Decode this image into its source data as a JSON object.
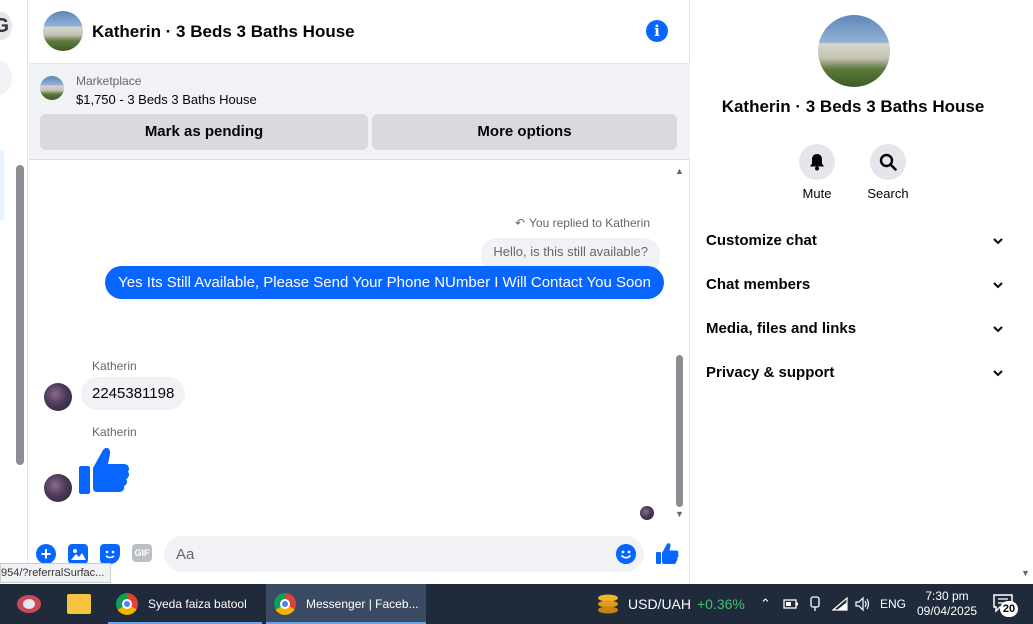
{
  "chat": {
    "title": "Katherin · 3 Beds 3 Baths House",
    "marketplace": {
      "label": "Marketplace",
      "listing": "$1,750 - 3 Beds 3 Baths House",
      "pending_label": "Mark as pending",
      "more_label": "More options"
    },
    "messages": {
      "replied_label": "You replied to Katherin",
      "quoted": "Hello, is this still available?",
      "outgoing": "Yes Its Still Available, Please Send Your Phone NUmber I Will Contact You Soon",
      "sender1": "Katherin",
      "incoming": "2245381198",
      "sender2": "Katherin"
    },
    "composer": {
      "placeholder": "Aa",
      "gif_label": "GIF"
    }
  },
  "url_hint": "954/?referralSurfac...",
  "details": {
    "title": "Katherin · 3 Beds 3 Baths House",
    "actions": [
      {
        "label": "Mute",
        "icon": "bell-icon"
      },
      {
        "label": "Search",
        "icon": "search-icon"
      }
    ],
    "sections": [
      {
        "label": "Customize chat"
      },
      {
        "label": "Chat members"
      },
      {
        "label": "Media, files and links"
      },
      {
        "label": "Privacy & support"
      }
    ]
  },
  "taskbar": {
    "apps": [
      {
        "label": "Syeda faiza batool -..."
      },
      {
        "label": "Messenger | Faceb..."
      }
    ],
    "ticker": {
      "name": "USD/UAH",
      "change": "+0.36%"
    },
    "language": "ENG",
    "time": "7:30 pm",
    "date": "09/04/2025",
    "notifications": "20"
  },
  "colors": {
    "accent": "#0866ff",
    "bubble_gray": "#f0f2f5",
    "taskbar": "#1f2a3a",
    "ticker_up": "#3ec46d"
  }
}
